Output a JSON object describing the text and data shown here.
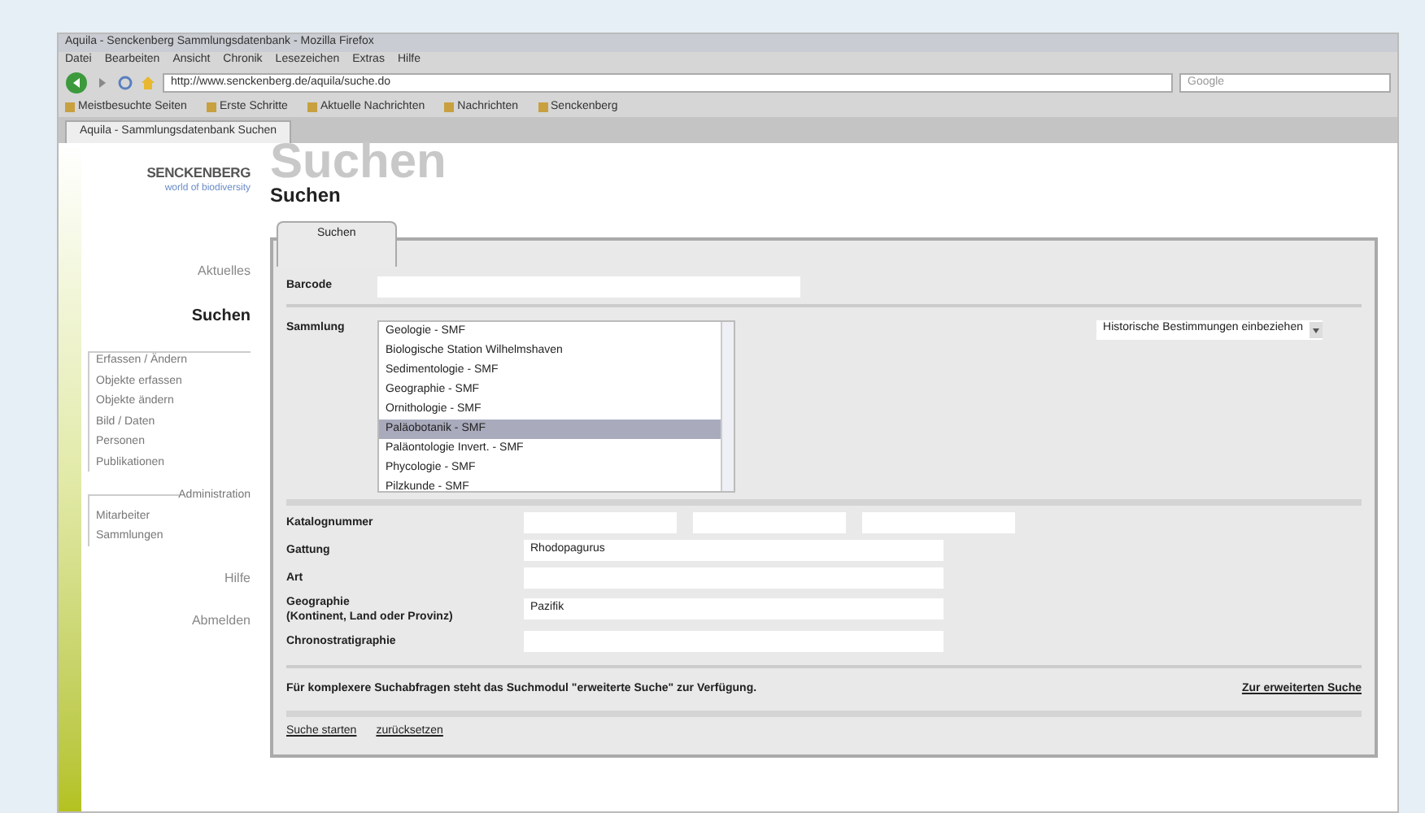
{
  "browser": {
    "title": "Aquila - Senckenberg Sammlungsdatenbank - Mozilla Firefox",
    "menu": [
      "Datei",
      "Bearbeiten",
      "Ansicht",
      "Chronik",
      "Lesezeichen",
      "Extras",
      "Hilfe"
    ],
    "address": "http://www.senckenberg.de/aquila/suche.do",
    "search_placeholder": "Google",
    "bookmarks": [
      "Meistbesuchte Seiten",
      "Erste Schritte",
      "Aktuelle Nachrichten",
      "Nachrichten",
      "Senckenberg"
    ],
    "tab": "Aquila - Sammlungsdatenbank Suchen"
  },
  "logo": {
    "name": "SENCKENBERG",
    "tagline": "world of biodiversity"
  },
  "heading_watermark": "Suchen",
  "heading": "Suchen",
  "sidebar": [
    {
      "label": "Aktuelles",
      "kind": "main",
      "selected": false
    },
    {
      "label": "Suchen",
      "kind": "main",
      "selected": true
    },
    {
      "kind": "group",
      "items": [
        "Erfassen / Ändern",
        "Objekte erfassen",
        "Objekte ändern",
        "Bild / Daten",
        "Personen",
        "Publikationen"
      ]
    },
    {
      "kind": "group",
      "title": "Administration",
      "items": [
        "Mitarbeiter",
        "Sammlungen"
      ]
    },
    {
      "label": "Hilfe",
      "kind": "main",
      "selected": false
    },
    {
      "label": "Abmelden",
      "kind": "main",
      "selected": false
    }
  ],
  "tabs": [
    {
      "label": "Suchen",
      "selected": true
    }
  ],
  "barcode": {
    "label": "Barcode"
  },
  "collection": {
    "label": "Sammlung",
    "items": [
      {
        "label": "Geologie - SMF",
        "selected": false
      },
      {
        "label": "Biologische Station Wilhelmshaven",
        "selected": false
      },
      {
        "label": "Sedimentologie - SMF",
        "selected": false
      },
      {
        "label": "Geographie - SMF",
        "selected": false
      },
      {
        "label": "Ornithologie - SMF",
        "selected": false
      },
      {
        "label": "Paläobotanik - SMF",
        "selected": true
      },
      {
        "label": "Paläontologie Invert. - SMF",
        "selected": false
      },
      {
        "label": "Phycologie - SMF",
        "selected": false
      },
      {
        "label": "Pilzkunde - SMF",
        "selected": false
      }
    ]
  },
  "historic": {
    "value": "Historische Bestimmungen einbeziehen"
  },
  "fields": [
    {
      "label": "Katalognummer",
      "kind": "triple"
    },
    {
      "label": "Gattung",
      "kind": "text",
      "value": "Rhodopagurus"
    },
    {
      "label": "Art",
      "kind": "text"
    },
    {
      "label": "Geographie",
      "label2": "(Kontinent, Land oder Provinz)",
      "kind": "text",
      "value": "Pazifik"
    },
    {
      "label": "Chronostratigraphie",
      "kind": "text"
    }
  ],
  "note": "Für komplexere Suchabfragen steht das Suchmodul \"erweiterte Suche\" zur Verfügung.",
  "advanced_link": "Zur erweiterten Suche",
  "actions": [
    "Suche starten",
    "zurücksetzen"
  ]
}
